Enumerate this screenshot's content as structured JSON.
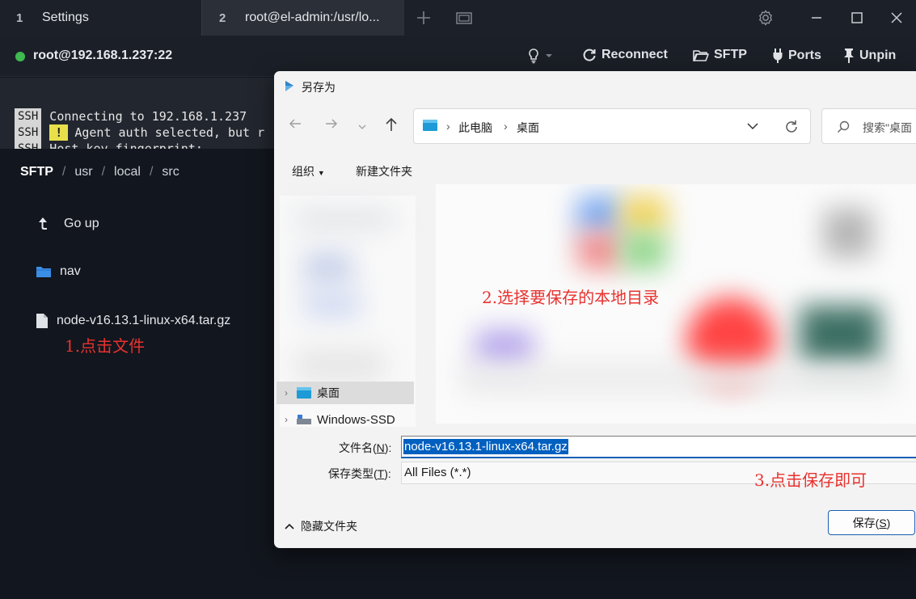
{
  "tabs": [
    {
      "number": "1",
      "title": "Settings"
    },
    {
      "number": "2",
      "title": "root@el-admin:/usr/lo..."
    }
  ],
  "toolbar": {
    "host": "root@192.168.1.237:22",
    "reconnect": "Reconnect",
    "sftp": "SFTP",
    "ports": "Ports",
    "unpin": "Unpin"
  },
  "terminal": {
    "lines": [
      {
        "tag": "SSH",
        "text": "Connecting to 192.168.1.237"
      },
      {
        "tag": "SSH",
        "warn": "!",
        "text": "Agent auth selected, but r"
      },
      {
        "tag": "SSH",
        "text": "Host key fingerprint:"
      }
    ]
  },
  "sftp": {
    "root": "SFTP",
    "path": [
      "usr",
      "local",
      "src"
    ],
    "go_up": "Go up",
    "items": [
      {
        "name": "nav",
        "icon": "folder-icon"
      },
      {
        "name": "node-v16.13.1-linux-x64.tar.gz",
        "icon": "file-icon"
      }
    ]
  },
  "annotations": {
    "step1": "1.点击文件",
    "step2": "2.选择要保存的本地目录",
    "step3": "3.点击保存即可"
  },
  "dialog": {
    "title": "另存为",
    "address": [
      "此电脑",
      "桌面"
    ],
    "search_placeholder": "搜索\"桌面",
    "organize": "组织",
    "new_folder": "新建文件夹",
    "nav_items": [
      "桌面",
      "Windows-SSD"
    ],
    "filename_label": "文件名(",
    "filename_key": "N",
    "filename_label_end": "):",
    "filename": "node-v16.13.1-linux-x64.tar.gz",
    "filetype_label": "保存类型(",
    "filetype_key": "T",
    "filetype_label_end": "):",
    "filetype": "All Files (*.*)",
    "hide_folders": "隐藏文件夹",
    "save_label": "保存(",
    "save_key": "S",
    "save_label_end": ")"
  },
  "colors": {
    "accent": "#0060c0",
    "annotation": "#e8322f",
    "status_connected": "#3fb950",
    "folder": "#3a8ee6"
  }
}
